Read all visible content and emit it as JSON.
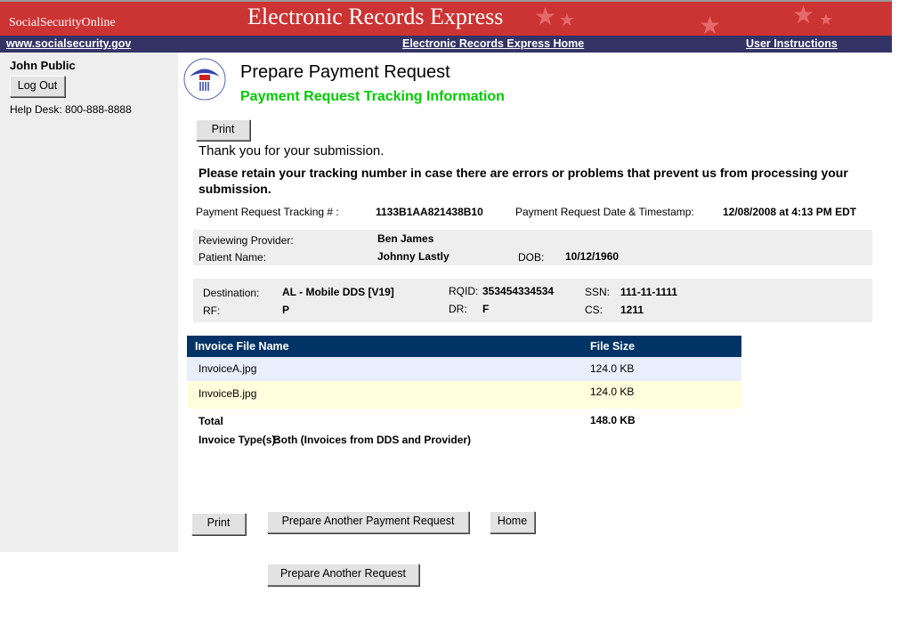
{
  "header": {
    "brand": "SocialSecurityOnline",
    "title": "Electronic Records Express"
  },
  "nav": {
    "site_link": "www.socialsecurity.gov",
    "home_link": "Electronic Records Express Home",
    "instructions_link": "User Instructions"
  },
  "sidebar": {
    "user_name": "John Public",
    "logout_label": "Log Out",
    "help_desk": "Help Desk: 800-888-8888"
  },
  "page": {
    "title": "Prepare Payment Request",
    "subtitle": "Payment Request Tracking Information",
    "print_label": "Print",
    "thanks": "Thank you for your submission.",
    "retain_note": "Please retain your tracking number in case there are errors or problems that prevent us from processing your submission.",
    "tracking_label": "Payment Request Tracking # :",
    "tracking_value": "1133B1AA821438B10",
    "timestamp_label": "Payment Request Date & Timestamp:",
    "timestamp_value": "12/08/2008 at 4:13 PM EDT"
  },
  "patient": {
    "provider_label": "Reviewing Provider:",
    "provider_value": "Ben James",
    "patient_label": "Patient Name:",
    "patient_value": "Johnny Lastly",
    "dob_label": "DOB:",
    "dob_value": "10/12/1960"
  },
  "claim": {
    "destination_label": "Destination:",
    "destination_value": "AL - Mobile DDS [V19]",
    "rqid_label": "RQID:",
    "rqid_value": "353454334534",
    "ssn_label": "SSN:",
    "ssn_value": "111-11-1111",
    "rf_label": "RF:",
    "rf_value": "P",
    "dr_label": "DR:",
    "dr_value": "F",
    "cs_label": "CS:",
    "cs_value": "1211"
  },
  "invoices": {
    "headers": [
      "Invoice File Name",
      "File Size"
    ],
    "rows": [
      {
        "name": "InvoiceA.jpg",
        "size": "124.0 KB"
      },
      {
        "name": "InvoiceB.jpg",
        "size": "124.0 KB"
      }
    ],
    "total_label": "Total",
    "total_value": "148.0 KB",
    "type_label": "Invoice Type(s):",
    "type_value": "Both (Invoices from DDS and Provider)"
  },
  "buttons": {
    "print": "Print",
    "another_payment": "Prepare Another Payment Request",
    "home": "Home",
    "another_request": "Prepare Another Request"
  },
  "colors": {
    "header_red": "#cc3333",
    "nav_navy": "#333366",
    "table_header": "#003366",
    "subtitle_green": "#00cc00"
  }
}
